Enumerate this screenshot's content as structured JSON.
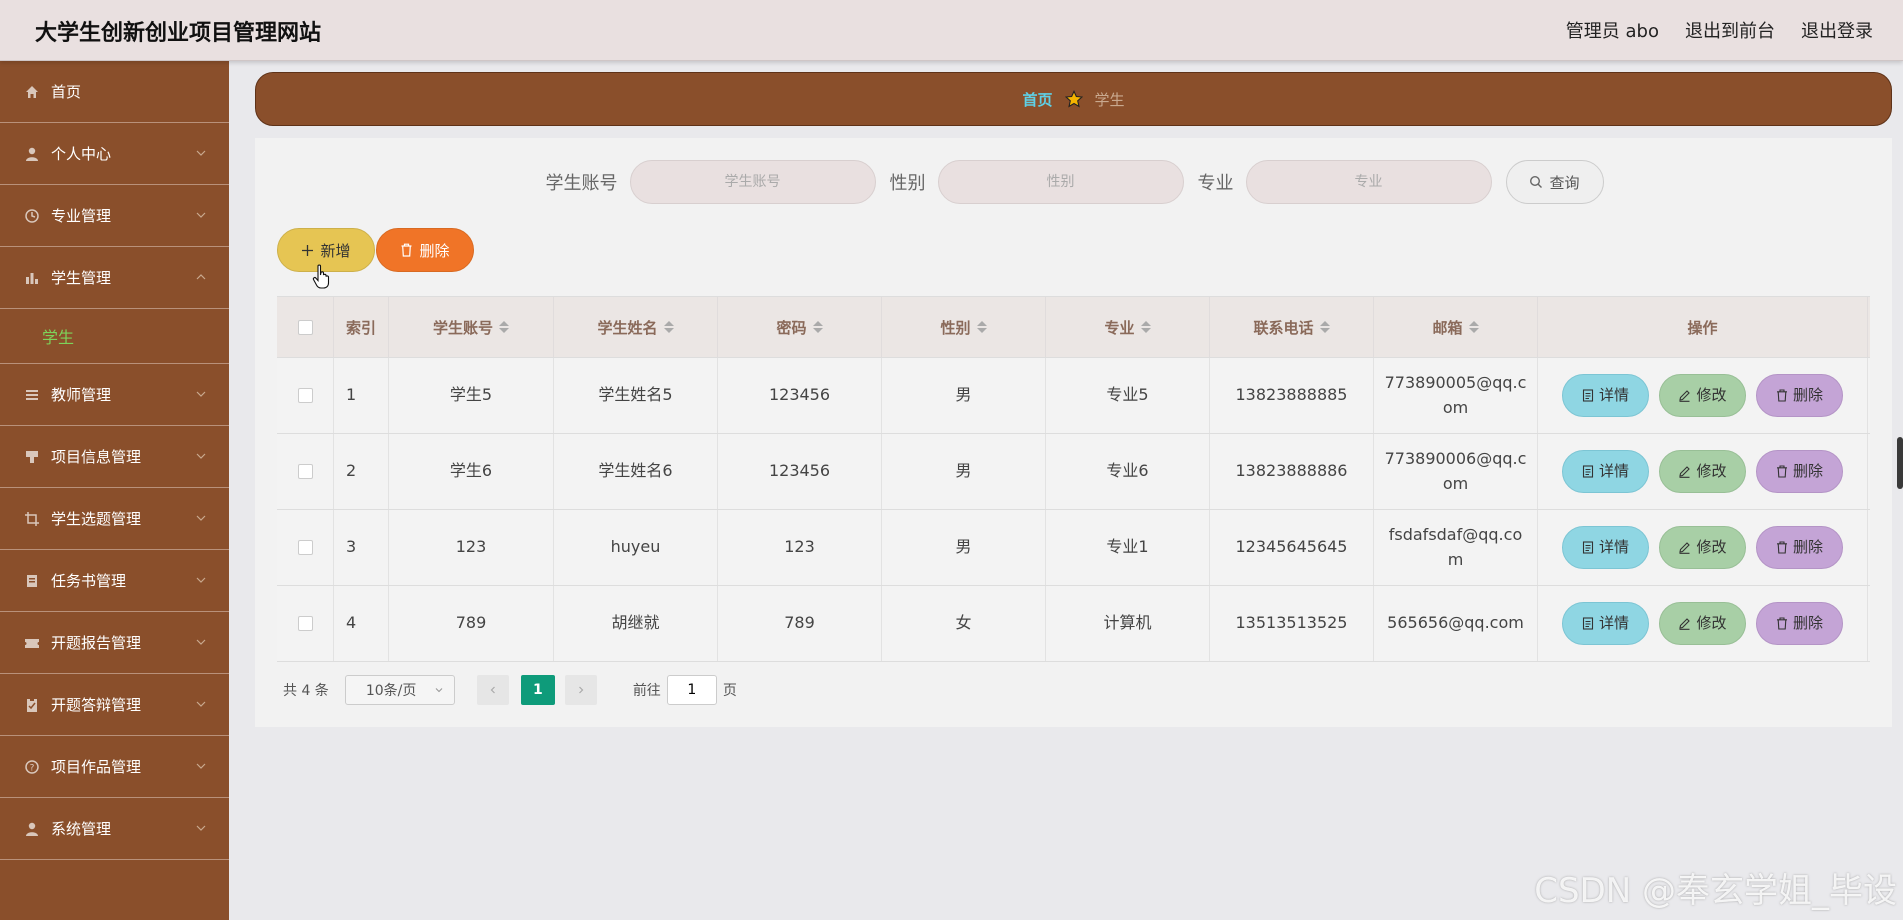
{
  "header": {
    "site_title": "大学生创新创业项目管理网站",
    "admin_label": "管理员 abo",
    "back_to_front": "退出到前台",
    "logout": "退出登录"
  },
  "sidebar": {
    "items": [
      {
        "label": "首页",
        "icon": "home-icon"
      },
      {
        "label": "个人中心",
        "icon": "user-icon"
      },
      {
        "label": "专业管理",
        "icon": "clock-icon"
      },
      {
        "label": "学生管理",
        "icon": "bar-chart-icon",
        "expanded": true
      },
      {
        "label": "教师管理",
        "icon": "list-icon"
      },
      {
        "label": "项目信息管理",
        "icon": "stamp-icon"
      },
      {
        "label": "学生选题管理",
        "icon": "crop-icon"
      },
      {
        "label": "任务书管理",
        "icon": "book-icon"
      },
      {
        "label": "开题报告管理",
        "icon": "ticket-icon"
      },
      {
        "label": "开题答辩管理",
        "icon": "clipboard-icon"
      },
      {
        "label": "项目作品管理",
        "icon": "help-circle-icon"
      },
      {
        "label": "系统管理",
        "icon": "user-icon"
      }
    ],
    "sub_item": "学生"
  },
  "breadcrumb": {
    "home": "首页",
    "current": "学生"
  },
  "search": {
    "fields": [
      {
        "label": "学生账号",
        "placeholder": "学生账号"
      },
      {
        "label": "性别",
        "placeholder": "性别"
      },
      {
        "label": "专业",
        "placeholder": "专业"
      }
    ],
    "button": "查询"
  },
  "actions": {
    "add": "新增",
    "delete": "删除"
  },
  "table": {
    "columns": [
      "索引",
      "学生账号",
      "学生姓名",
      "密码",
      "性别",
      "专业",
      "联系电话",
      "邮箱",
      "操作"
    ],
    "rows": [
      {
        "index": "1",
        "account": "学生5",
        "name": "学生姓名5",
        "password": "123456",
        "gender": "男",
        "major": "专业5",
        "phone": "13823888885",
        "email": "773890005@qq.com"
      },
      {
        "index": "2",
        "account": "学生6",
        "name": "学生姓名6",
        "password": "123456",
        "gender": "男",
        "major": "专业6",
        "phone": "13823888886",
        "email": "773890006@qq.com"
      },
      {
        "index": "3",
        "account": "123",
        "name": "huyeu",
        "password": "123",
        "gender": "男",
        "major": "专业1",
        "phone": "12345645645",
        "email": "fsdafsdaf@qq.com"
      },
      {
        "index": "4",
        "account": "789",
        "name": "胡继就",
        "password": "789",
        "gender": "女",
        "major": "计算机",
        "phone": "13513513525",
        "email": "565656@qq.com"
      }
    ],
    "row_actions": {
      "detail": "详情",
      "edit": "修改",
      "delete": "删除"
    }
  },
  "pagination": {
    "total": "共 4 条",
    "page_size": "10条/页",
    "current_page": "1",
    "goto_label": "前往",
    "goto_value": "1",
    "page_suffix": "页"
  },
  "watermark": "CSDN @奉玄学姐_毕设",
  "colors": {
    "sidebar_bg": "#8a4f2b",
    "header_bg": "#e9e0e0",
    "active_sub": "#7dd35a",
    "add_btn": "#e6c553",
    "delete_btn": "#f07427",
    "detail_btn": "#8fd6e3",
    "edit_btn": "#a8cfa6",
    "row_delete_btn": "#c4a4d6",
    "pager_active": "#0e9b7a"
  }
}
